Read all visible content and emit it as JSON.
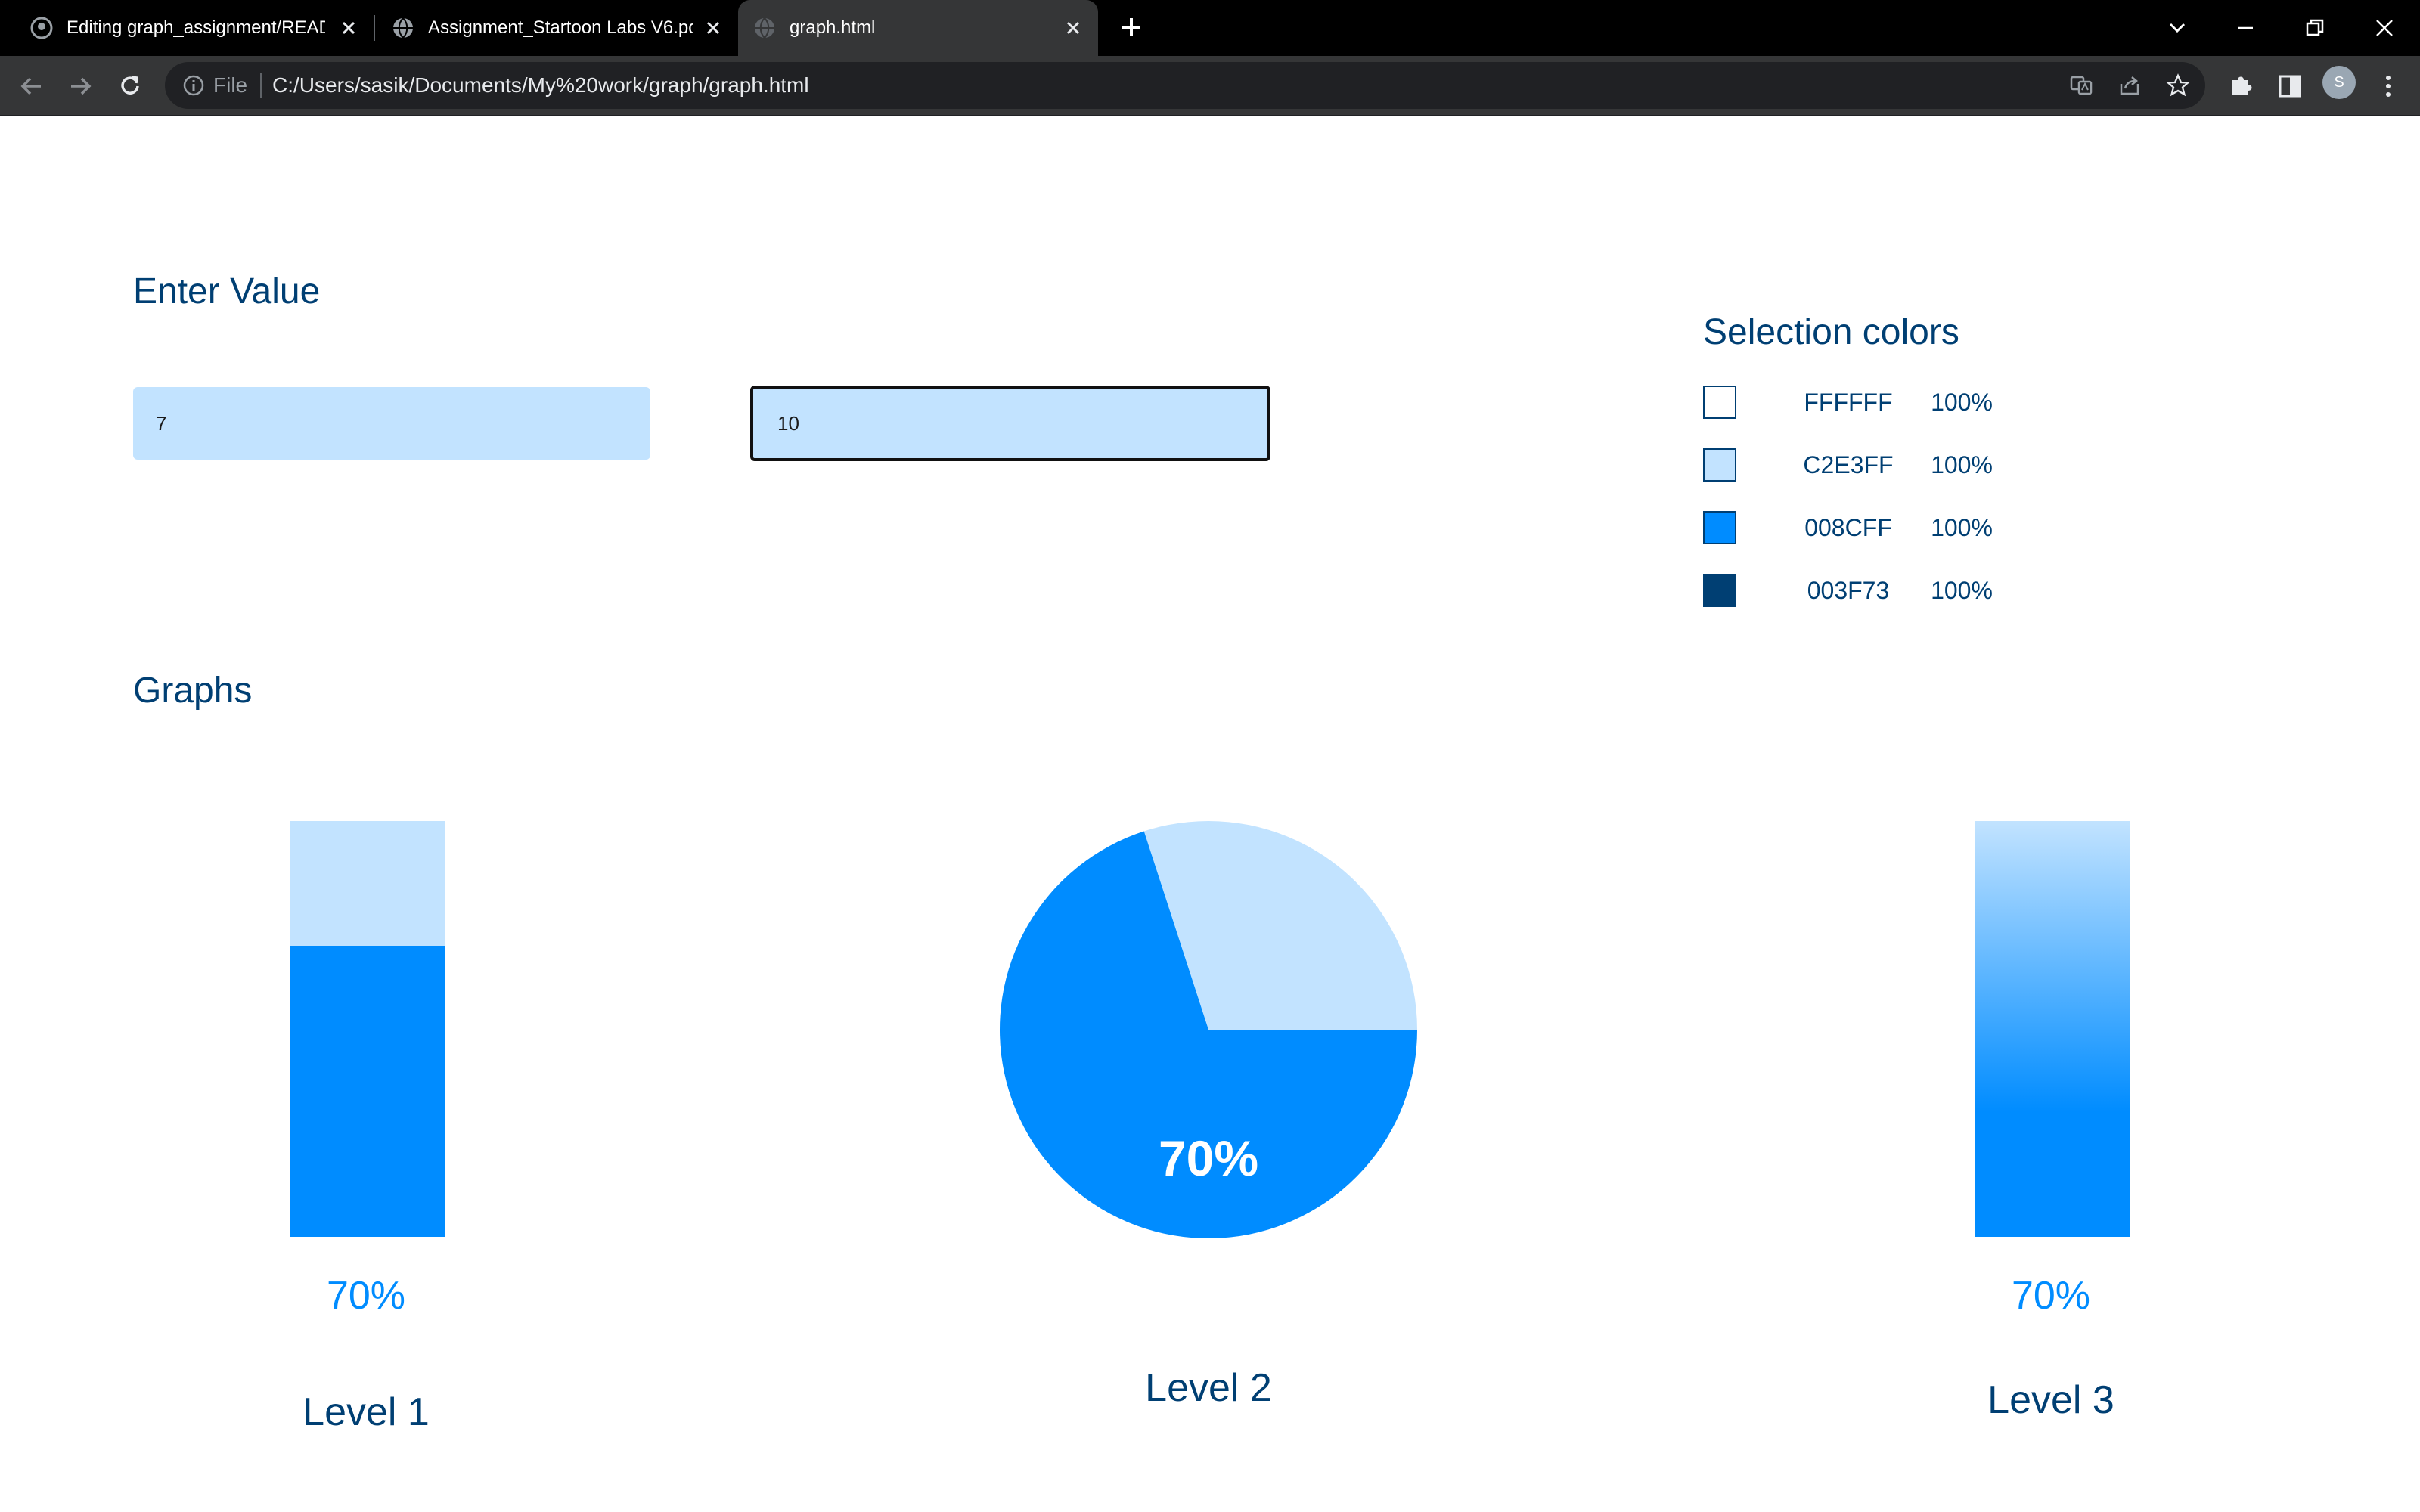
{
  "browser": {
    "tabs": [
      {
        "title": "Editing graph_assignment/README.md"
      },
      {
        "title": "Assignment_Startoon Labs V6.pdf"
      },
      {
        "title": "graph.html"
      }
    ],
    "address": {
      "scheme_label": "File",
      "url": "C:/Users/sasik/Documents/My%20work/graph/graph.html"
    },
    "profile_initial": "S"
  },
  "inputs_section": {
    "title": "Enter Value",
    "input_1": "7",
    "input_2": "10"
  },
  "selection_colors": {
    "title": "Selection colors",
    "items": [
      {
        "hex": "FFFFFF",
        "percent": "100%",
        "color": "#FFFFFF"
      },
      {
        "hex": "C2E3FF",
        "percent": "100%",
        "color": "#C2E3FF"
      },
      {
        "hex": "008CFF",
        "percent": "100%",
        "color": "#008CFF"
      },
      {
        "hex": "003F73",
        "percent": "100%",
        "color": "#003F73"
      }
    ]
  },
  "graphs": {
    "title": "Graphs",
    "level1": {
      "label": "Level 1",
      "percent_text": "70%"
    },
    "level2": {
      "label": "Level 2",
      "percent_text": "70%"
    },
    "level3": {
      "label": "Level 3",
      "percent_text": "70%"
    }
  },
  "chart_data": [
    {
      "type": "bar",
      "categories": [
        "Level 1"
      ],
      "values": [
        70
      ],
      "ylim": [
        0,
        100
      ],
      "title": "",
      "xlabel": "",
      "ylabel": ""
    },
    {
      "type": "pie",
      "categories": [
        "Level 2",
        ""
      ],
      "values": [
        70,
        30
      ],
      "title": ""
    },
    {
      "type": "bar",
      "categories": [
        "Level 3"
      ],
      "values": [
        70
      ],
      "ylim": [
        0,
        100
      ],
      "title": "",
      "xlabel": "",
      "ylabel": "",
      "style": "gradient"
    }
  ],
  "theme": {
    "light": "#C2E3FF",
    "accent": "#008CFF",
    "dark": "#003F73"
  }
}
